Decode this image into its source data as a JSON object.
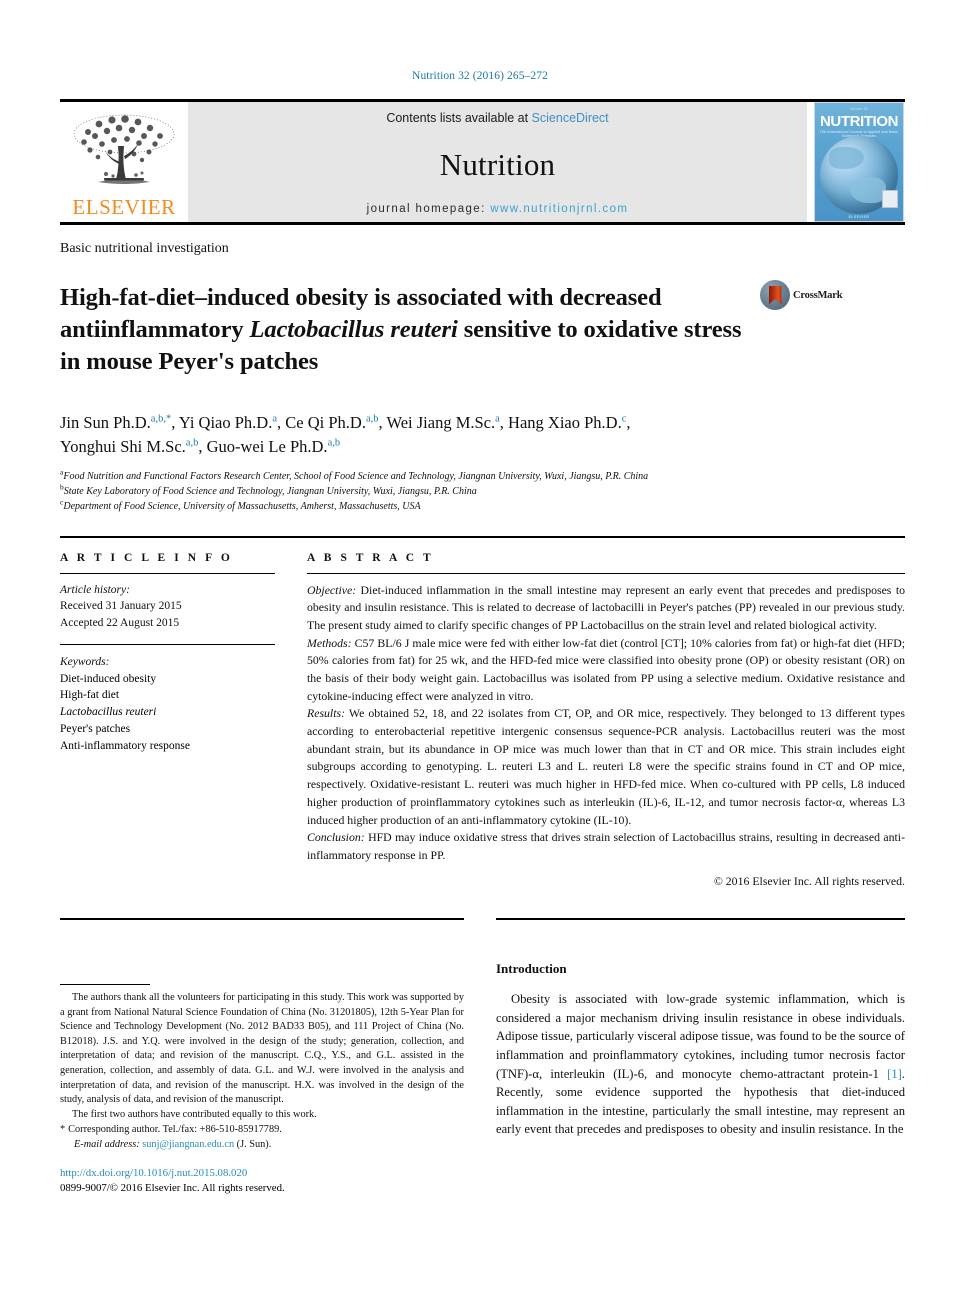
{
  "running_head": "Nutrition 32 (2016) 265–272",
  "masthead": {
    "publisher_name": "ELSEVIER",
    "contents_prefix": "Contents lists available at ",
    "contents_link": "ScienceDirect",
    "journal_name": "Nutrition",
    "homepage_prefix": "journal homepage: ",
    "homepage_url": "www.nutritionjrnl.com",
    "cover": {
      "top_tiny": "Volume 32",
      "title": "NUTRITION",
      "subtitle": "The International Journal of Applied and Basic Nutritional Sciences",
      "foot": "ELSEVIER"
    }
  },
  "section_label": "Basic nutritional investigation",
  "title_parts": {
    "line1": "High-fat-diet–induced obesity is associated with decreased",
    "line2a": "antiinflammatory ",
    "line2_italic": "Lactobacillus reuteri",
    "line2b": " sensitive to oxidative stress",
    "line3": "in mouse Peyer's patches"
  },
  "crossmark_label": "CrossMark",
  "authors": [
    {
      "name": "Jin Sun Ph.D.",
      "sup": "a,b,*",
      "sep": ", "
    },
    {
      "name": "Yi Qiao Ph.D.",
      "sup": "a",
      "sep": ", "
    },
    {
      "name": "Ce Qi Ph.D.",
      "sup": "a,b",
      "sep": ", "
    },
    {
      "name": "Wei Jiang M.Sc.",
      "sup": "a",
      "sep": ", "
    },
    {
      "name": "Hang Xiao Ph.D.",
      "sup": "c",
      "sep": ", "
    },
    {
      "name": "Yonghui Shi M.Sc.",
      "sup": "a,b",
      "sep": ", "
    },
    {
      "name": "Guo-wei Le Ph.D.",
      "sup": "a,b",
      "sep": ""
    }
  ],
  "affiliations": [
    {
      "sup": "a",
      "text": "Food Nutrition and Functional Factors Research Center, School of Food Science and Technology, Jiangnan University, Wuxi, Jiangsu, P.R. China"
    },
    {
      "sup": "b",
      "text": "State Key Laboratory of Food Science and Technology, Jiangnan University, Wuxi, Jiangsu, P.R. China"
    },
    {
      "sup": "c",
      "text": "Department of Food Science, University of Massachusetts, Amherst, Massachusetts, USA"
    }
  ],
  "article_info": {
    "heading": "A R T I C L E  I N F O",
    "history_label": "Article history:",
    "received": "Received 31 January 2015",
    "accepted": "Accepted 22 August 2015",
    "keywords_label": "Keywords:",
    "keywords": [
      {
        "text": "Diet-induced obesity",
        "italic": false
      },
      {
        "text": "High-fat diet",
        "italic": false
      },
      {
        "text": "Lactobacillus reuteri",
        "italic": true
      },
      {
        "text": "Peyer's patches",
        "italic": false
      },
      {
        "text": "Anti-inflammatory response",
        "italic": false
      }
    ]
  },
  "abstract": {
    "heading": "A B S T R A C T",
    "objective_label": "Objective:",
    "objective_text": " Diet-induced inflammation in the small intestine may represent an early event that precedes and predisposes to obesity and insulin resistance. This is related to decrease of lactobacilli in Peyer's patches (PP) revealed in our previous study. The present study aimed to clarify specific changes of PP Lactobacillus on the strain level and related biological activity.",
    "methods_label": "Methods:",
    "methods_text": " C57 BL/6 J male mice were fed with either low-fat diet (control [CT]; 10% calories from fat) or high-fat diet (HFD; 50% calories from fat) for 25 wk, and the HFD-fed mice were classified into obesity prone (OP) or obesity resistant (OR) on the basis of their body weight gain. Lactobacillus was isolated from PP using a selective medium. Oxidative resistance and cytokine-inducing effect were analyzed in vitro.",
    "results_label": "Results:",
    "results_text": " We obtained 52, 18, and 22 isolates from CT, OP, and OR mice, respectively. They belonged to 13 different types according to enterobacterial repetitive intergenic consensus sequence-PCR analysis. Lactobacillus reuteri was the most abundant strain, but its abundance in OP mice was much lower than that in CT and OR mice. This strain includes eight subgroups according to genotyping. L. reuteri L3 and L. reuteri L8 were the specific strains found in CT and OP mice, respectively. Oxidative-resistant L. reuteri was much higher in HFD-fed mice. When co-cultured with PP cells, L8 induced higher production of proinflammatory cytokines such as interleukin (IL)-6, IL-12, and tumor necrosis factor-α, whereas L3 induced higher production of an anti-inflammatory cytokine (IL-10).",
    "conclusion_label": "Conclusion:",
    "conclusion_text": " HFD may induce oxidative stress that drives strain selection of Lactobacillus strains, resulting in decreased anti-inflammatory response in PP.",
    "copyright": "© 2016 Elsevier Inc. All rights reserved."
  },
  "footnotes": {
    "acknowledgment": "The authors thank all the volunteers for participating in this study. This work was supported by a grant from National Natural Science Foundation of China (No. 31201805), 12th 5-Year Plan for Science and Technology Development (No. 2012 BAD33 B05), and 111 Project of China (No. B12018). J.S. and Y.Q. were involved in the design of the study; generation, collection, and interpretation of data; and revision of the manuscript. C.Q., Y.S., and G.L. assisted in the generation, collection, and assembly of data. G.L. and W.J. were involved in the analysis and interpretation of data, and revision of the manuscript. H.X. was involved in the design of the study, analysis of data, and revision of the manuscript.",
    "equal_contribution": "The first two authors have contributed equally to this work.",
    "corresponding_symbol": "*",
    "corresponding": "Corresponding author. Tel./fax: +86-510-85917789.",
    "email_label": "E-mail address:",
    "email": "sunj@jiangnan.edu.cn",
    "email_suffix": " (J. Sun).",
    "doi": "http://dx.doi.org/10.1016/j.nut.2015.08.020",
    "issn_line": "0899-9007/© 2016 Elsevier Inc. All rights reserved."
  },
  "introduction": {
    "heading": "Introduction",
    "paragraph_a": "Obesity is associated with low-grade systemic inflammation, which is considered a major mechanism driving insulin resistance in obese individuals. Adipose tissue, particularly visceral adipose tissue, was found to be the source of inflammation and proinflammatory cytokines, including tumor necrosis factor (TNF)-α, interleukin (IL)-6, and monocyte chemo-attractant protein-1 ",
    "citation": "[1]",
    "paragraph_b": ". Recently, some evidence supported the hypothesis that diet-induced inflammation in the intestine, particularly the small intestine, may represent an early event that precedes and predisposes to obesity and insulin resistance. In the"
  },
  "colors": {
    "link_blue": "#2a8cc0",
    "running_head_blue": "#1a7ba8",
    "elsevier_orange": "#f08a22",
    "masthead_grey": "#e6e6e6"
  }
}
